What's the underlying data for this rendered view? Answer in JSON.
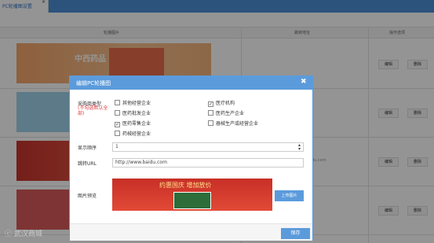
{
  "tab": {
    "label": "PC轮播图设置",
    "close": "×"
  },
  "table": {
    "headers": {
      "image": "轮播图片",
      "url": "跳转地址",
      "actions": "操作选项"
    },
    "edit_label": "编辑",
    "delete_label": "删除",
    "banner1_text": "中西药品",
    "row3_url_fragment": "du.com"
  },
  "modal": {
    "title": "编辑PC轮播图",
    "close": "✖",
    "buyer_type_label": "采购商类型",
    "buyer_type_hint": "(不勾选默认全部)",
    "options": [
      {
        "label": "其他经营企业",
        "checked": false
      },
      {
        "label": "医疗机构",
        "checked": true
      },
      {
        "label": "医药批发企业",
        "checked": false
      },
      {
        "label": "医药生产企业",
        "checked": false
      },
      {
        "label": "医药零售企业",
        "checked": true
      },
      {
        "label": "器械生产或经营企业",
        "checked": false
      },
      {
        "label": "药械经营企业",
        "checked": false
      }
    ],
    "order_label": "显示顺序",
    "order_value": "1",
    "url_label": "跳转URL",
    "url_value": "http://www.baidu.com",
    "preview_label": "图片预览",
    "preview_text": "约惠国庆 增加放价",
    "upload_label": "上传图片",
    "save_label": "保存"
  },
  "watermark": "ⓒ 武汉商城",
  "colors": {
    "accent": "#5b9bdc",
    "topbar": "#4a90d6",
    "hint": "#e4393c"
  }
}
